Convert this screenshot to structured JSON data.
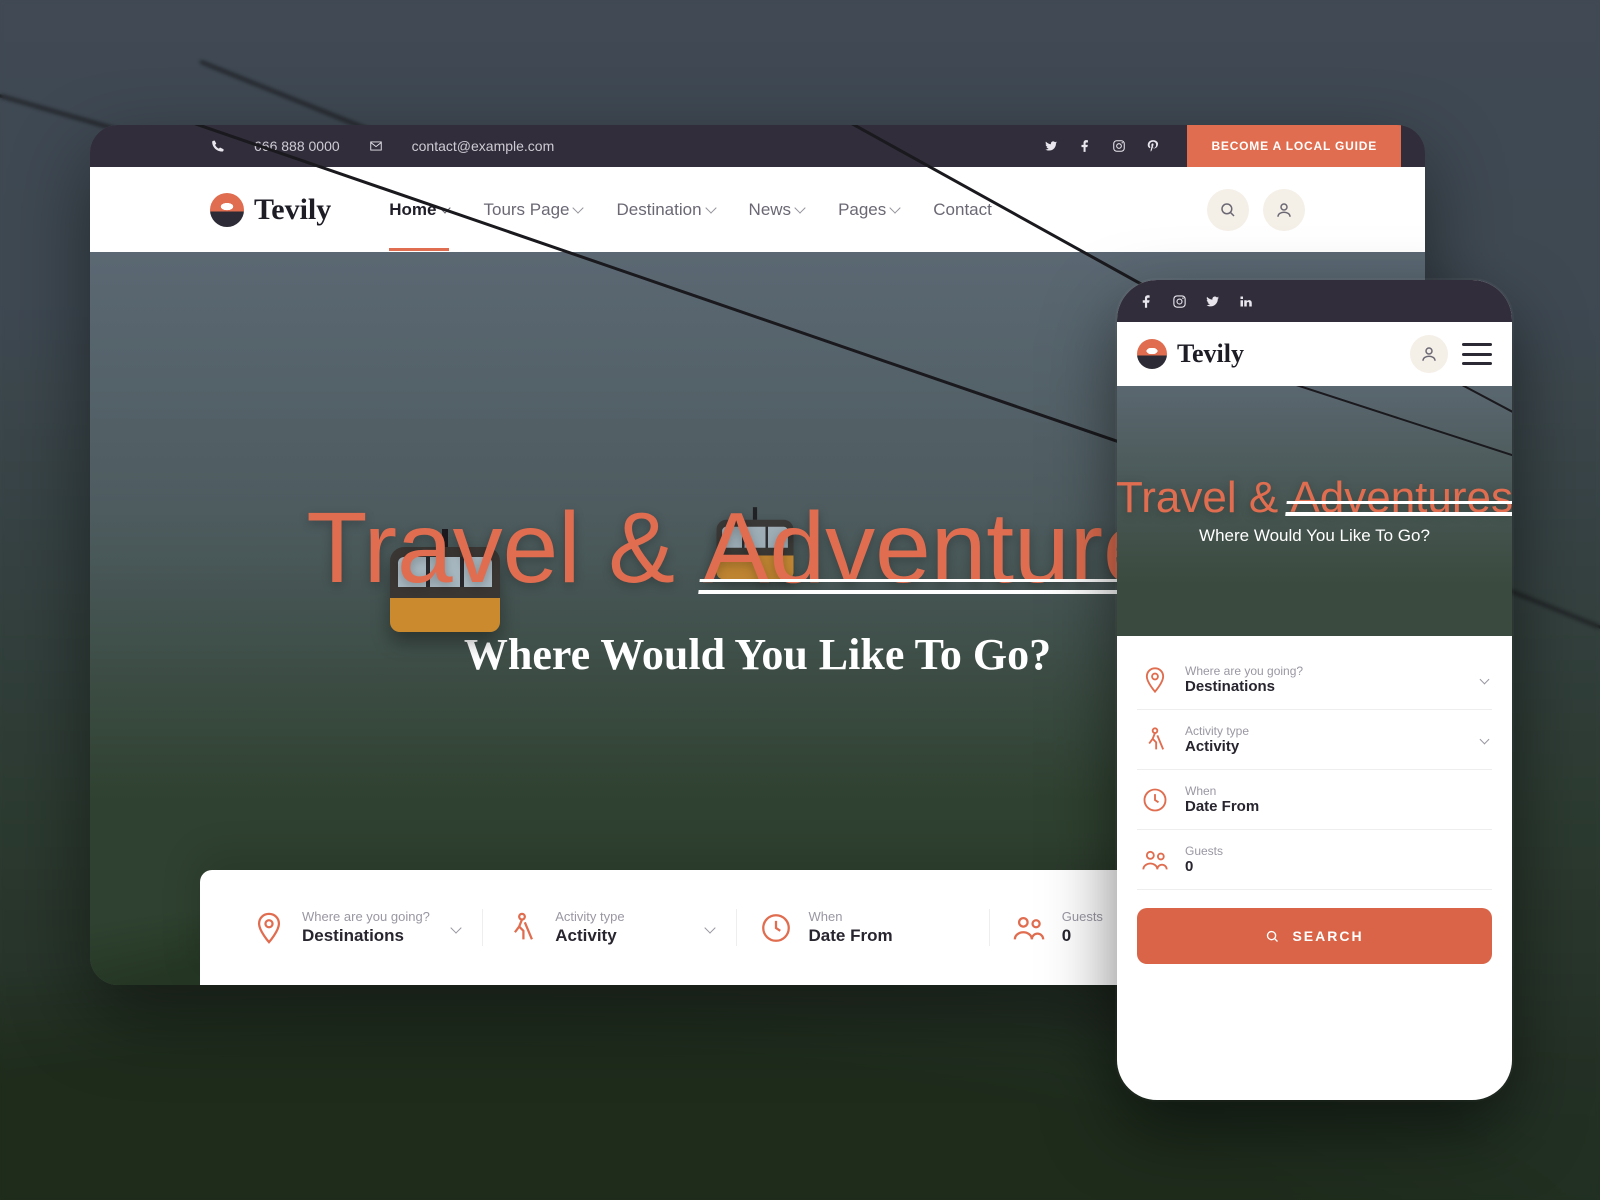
{
  "brand": {
    "name": "Tevily"
  },
  "topbar": {
    "phone": "666 888 0000",
    "email": "contact@example.com",
    "cta": "BECOME A LOCAL GUIDE",
    "socials": [
      "twitter",
      "facebook",
      "instagram",
      "pinterest"
    ]
  },
  "nav": {
    "items": [
      {
        "label": "Home",
        "dropdown": true,
        "active": true
      },
      {
        "label": "Tours Page",
        "dropdown": true,
        "active": false
      },
      {
        "label": "Destination",
        "dropdown": true,
        "active": false
      },
      {
        "label": "News",
        "dropdown": true,
        "active": false
      },
      {
        "label": "Pages",
        "dropdown": true,
        "active": false
      },
      {
        "label": "Contact",
        "dropdown": false,
        "active": false
      }
    ]
  },
  "hero": {
    "script_a": "Travel & ",
    "script_b": "Adventures",
    "subhead": "Where Would You Like To Go?"
  },
  "search": {
    "fields": [
      {
        "icon": "pin",
        "top": "Where are you going?",
        "bot": "Destinations",
        "caret": true
      },
      {
        "icon": "hiker",
        "top": "Activity type",
        "bot": "Activity",
        "caret": true
      },
      {
        "icon": "clock",
        "top": "When",
        "bot": "Date From",
        "caret": false
      },
      {
        "icon": "guests",
        "top": "Guests",
        "bot": "0",
        "caret": false
      }
    ],
    "button": "SEARCH"
  },
  "mobile_socials": [
    "facebook",
    "instagram",
    "twitter",
    "linkedin"
  ]
}
